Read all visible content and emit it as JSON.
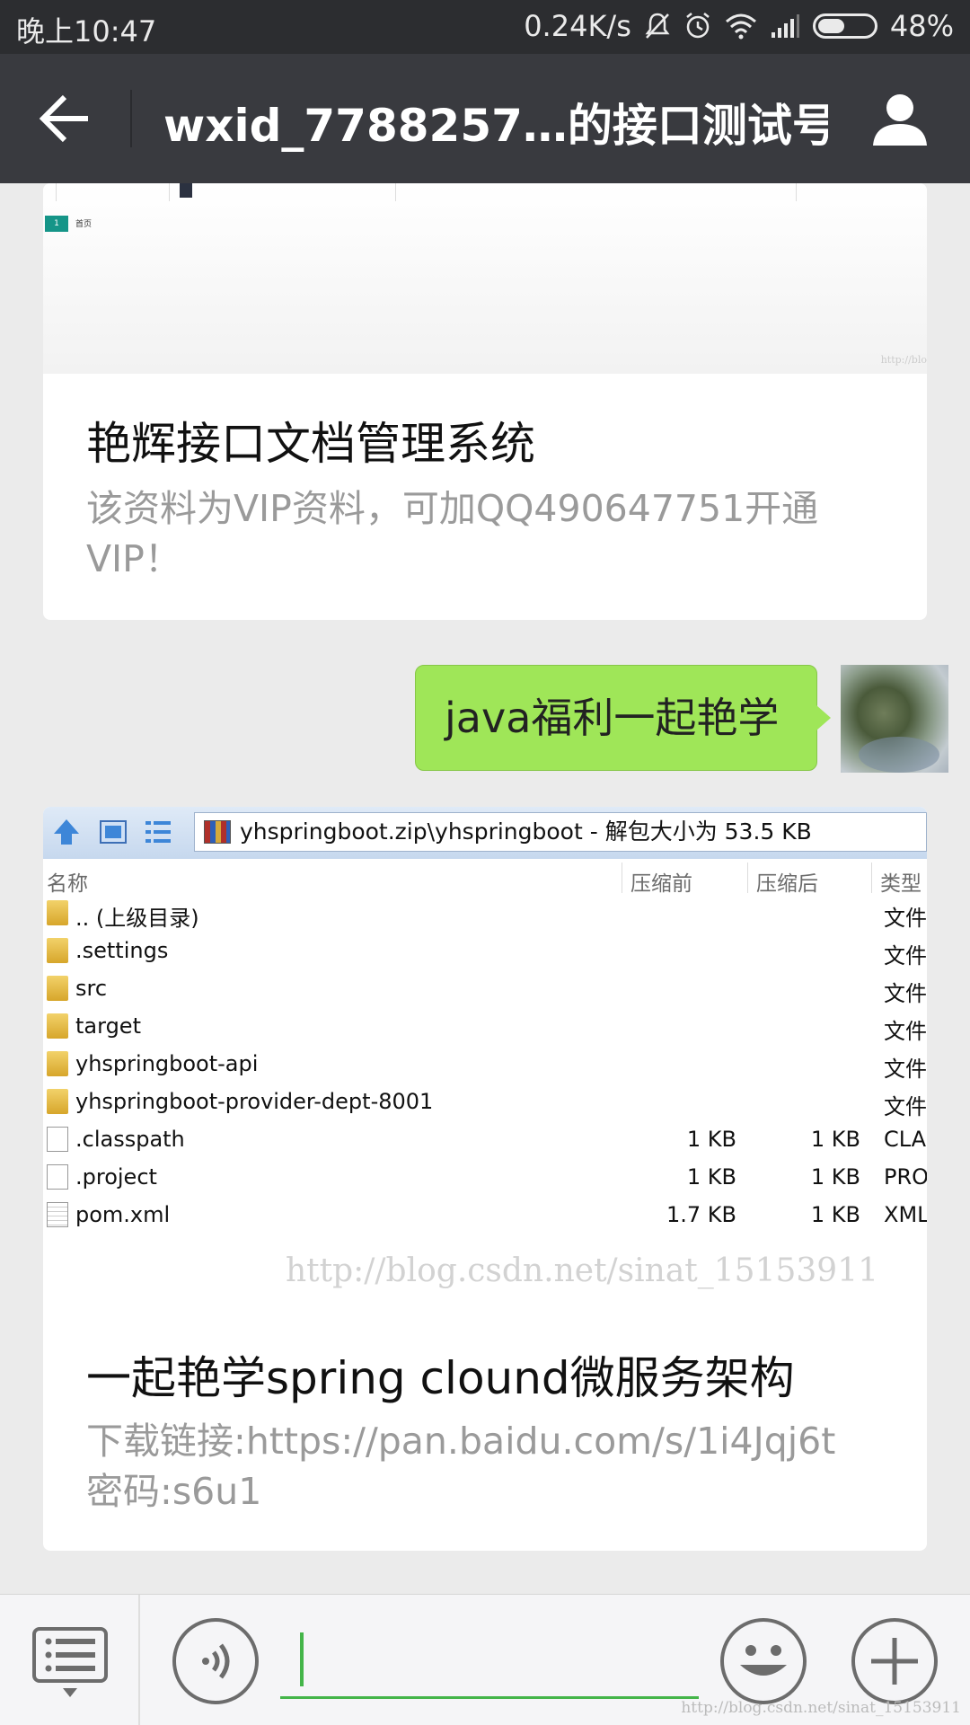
{
  "status_bar": {
    "time": "晚上10:47",
    "net_speed": "0.24K/s",
    "battery": "48%",
    "battery_level": 0.48
  },
  "header": {
    "title": "wxid_7788257…的接口测试号",
    "back_icon": "back-arrow-icon",
    "profile_icon": "profile-icon"
  },
  "messages": {
    "card1": {
      "preview_page_number": "1",
      "preview_page_label": "首页",
      "preview_watermark": "http://blo",
      "title": "艳辉接口文档管理系统",
      "description": "该资料为VIP资料，可加QQ490647751开通VIP！"
    },
    "sent_text": "java福利一起艳学",
    "card2": {
      "zip_path": "yhspringboot.zip\\yhspringboot - 解包大小为 53.5 KB",
      "columns": [
        "名称",
        "压缩前",
        "压缩后",
        "类型"
      ],
      "rows": [
        {
          "name": ".. (上级目录)",
          "before": "",
          "after": "",
          "type": "文件",
          "kind": "folder"
        },
        {
          "name": ".settings",
          "before": "",
          "after": "",
          "type": "文件",
          "kind": "folder"
        },
        {
          "name": "src",
          "before": "",
          "after": "",
          "type": "文件",
          "kind": "folder"
        },
        {
          "name": "target",
          "before": "",
          "after": "",
          "type": "文件",
          "kind": "folder"
        },
        {
          "name": "yhspringboot-api",
          "before": "",
          "after": "",
          "type": "文件",
          "kind": "folder"
        },
        {
          "name": "yhspringboot-provider-dept-8001",
          "before": "",
          "after": "",
          "type": "文件",
          "kind": "folder"
        },
        {
          "name": ".classpath",
          "before": "1 KB",
          "after": "1 KB",
          "type": "CLAS",
          "kind": "file"
        },
        {
          "name": ".project",
          "before": "1 KB",
          "after": "1 KB",
          "type": "PRO",
          "kind": "file"
        },
        {
          "name": "pom.xml",
          "before": "1.7 KB",
          "after": "1 KB",
          "type": "XML",
          "kind": "xml"
        }
      ],
      "watermark": "http://blog.csdn.net/sinat_15153911",
      "title": "一起艳学spring clound微服务架构",
      "description": "下载链接:https://pan.baidu.com/s/1i4Jqj6t  密码:s6u1"
    }
  },
  "input_bar": {
    "watermark": "http://blog.csdn.net/sinat_15153911"
  },
  "colors": {
    "status_bar": "#2c2d30",
    "title_bar": "#393a3f",
    "bubble": "#9fe658",
    "accent_green": "#44b549",
    "background": "#ebebeb"
  }
}
